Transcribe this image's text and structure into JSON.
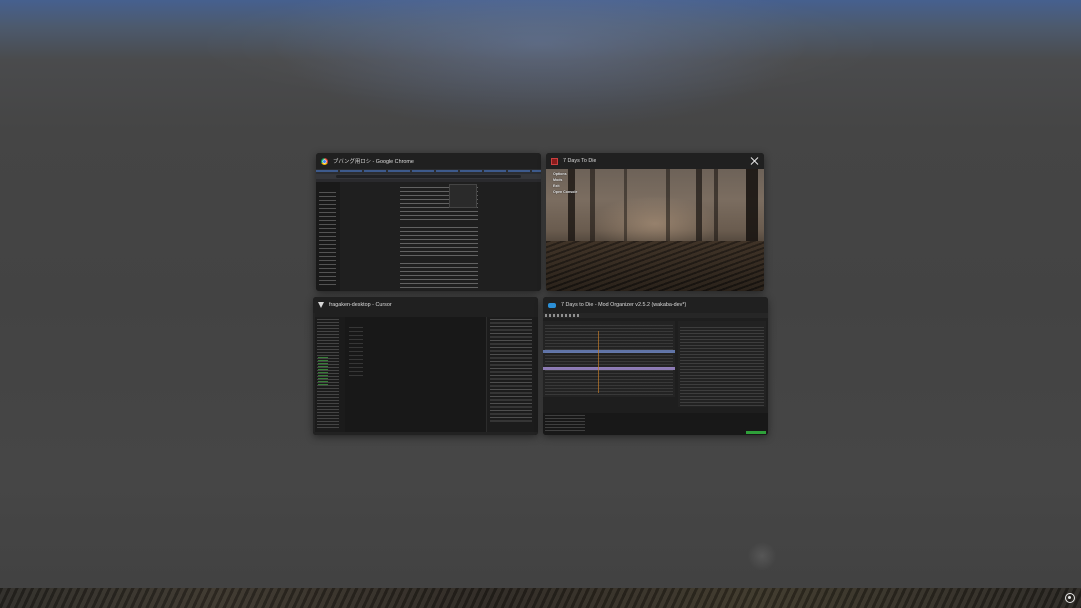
{
  "task_view": {
    "windows": [
      {
        "title": "ブバング用ロシ - Google Chrome",
        "icon": "chrome-icon",
        "app": "Google Chrome"
      },
      {
        "title": "7 Days To Die",
        "icon": "game-icon",
        "app": "7 Days To Die",
        "game_menu": [
          "Options",
          "Mods",
          "Exit",
          "Open Console"
        ]
      },
      {
        "title": "fragaken-desktop - Cursor",
        "icon": "cursor-icon",
        "app": "Cursor"
      },
      {
        "title": "7 Days to Die - Mod Organizer v2.5.2 (wakaba-dev*)",
        "icon": "mod-organizer-icon",
        "app": "Mod Organizer"
      }
    ],
    "close_icon": "close-icon"
  },
  "taskbar": {
    "tray_icon": "notification-center-icon"
  },
  "colors": {
    "card_background": "#202020",
    "overlay_background": "#434343",
    "accent_blue": "#46608f"
  }
}
